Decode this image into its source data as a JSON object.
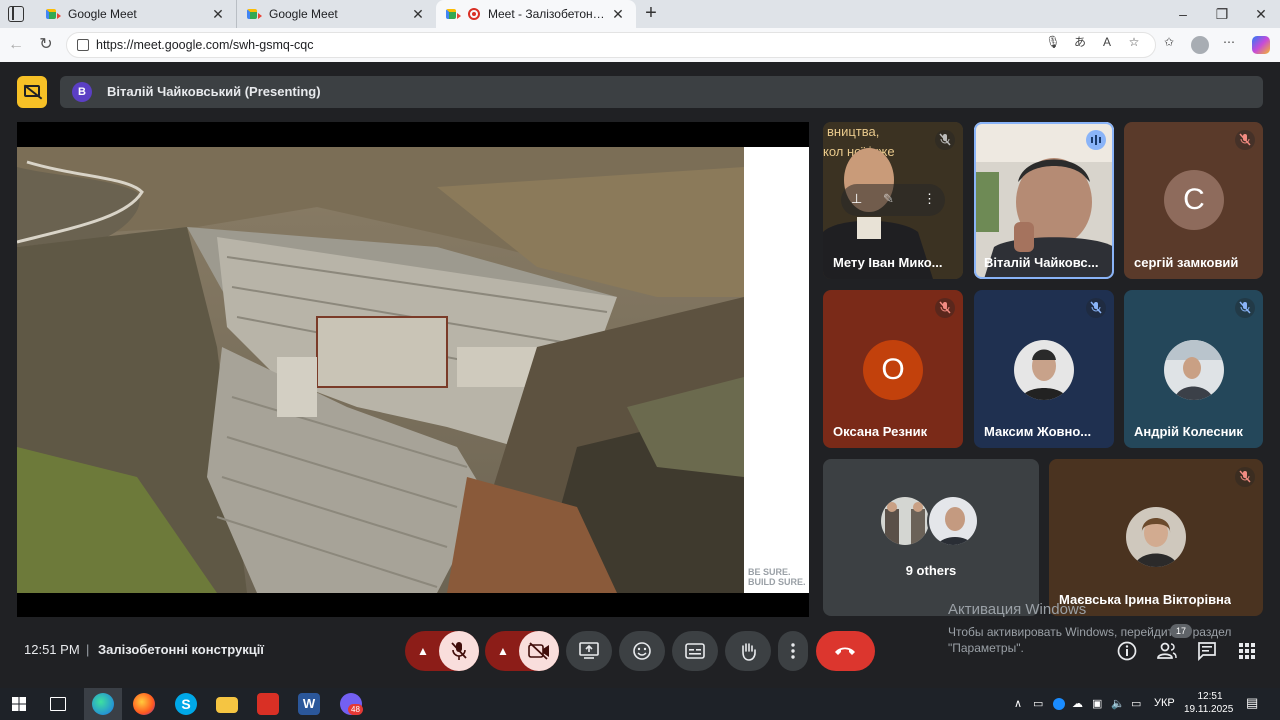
{
  "browser": {
    "tabs": [
      {
        "title": "Google Meet"
      },
      {
        "title": "Google Meet"
      },
      {
        "title": "Meet - Залізобетонні конструкції"
      }
    ],
    "new_tab": "+",
    "url": "https://meet.google.com/swh-gsmq-cqc"
  },
  "meet": {
    "presenter_initial": "В",
    "presenter_label": "Віталій Чайковський (Presenting)",
    "slide_tag_line1": "BE SURE.",
    "slide_tag_line2": "BUILD SURE.",
    "tiles": [
      {
        "name": "Мету Іван Мико..."
      },
      {
        "name": "Віталій Чайковс..."
      },
      {
        "name": "сергій замковий",
        "initial": "С"
      },
      {
        "name": "Оксана Резник",
        "initial": "О"
      },
      {
        "name": "Максим Жовно..."
      },
      {
        "name": "Андрій Колесник"
      },
      {
        "name": "Маєвська Ірина Вікторівна"
      }
    ],
    "others_label": "9 others",
    "time": "12:51 PM",
    "separator": "|",
    "meeting_title": "Залізобетонні конструкції",
    "people_badge": "17",
    "accent_color": "#8ab4f8",
    "hangup_color": "#dc362e"
  },
  "watermark": {
    "line1": "Активация Windows",
    "line2": "Чтобы активировать Windows, перейдите в раздел",
    "line3": "\"Параметры\"."
  },
  "taskbar": {
    "lang": "УКР",
    "time": "12:51",
    "date": "19.11.2025",
    "viber_badge": "48"
  }
}
